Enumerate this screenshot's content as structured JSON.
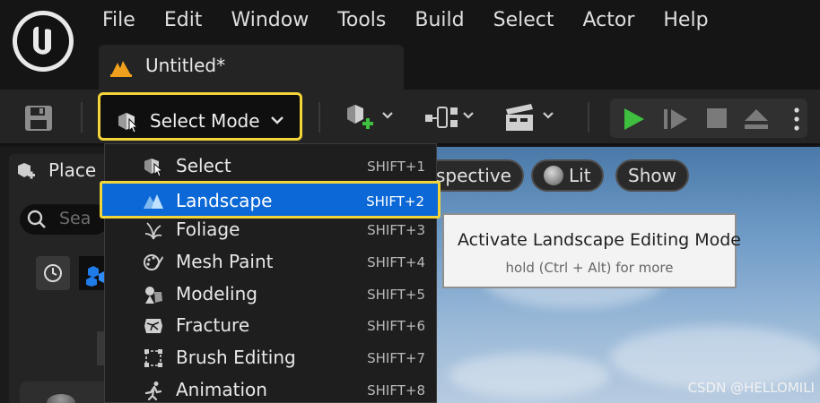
{
  "menu": [
    "File",
    "Edit",
    "Window",
    "Tools",
    "Build",
    "Select",
    "Actor",
    "Help"
  ],
  "document_tab": {
    "title": "Untitled*"
  },
  "toolbar": {
    "mode_button_label": "Select Mode",
    "accent_color": "#f3d53a",
    "play_color": "#3fbf3f"
  },
  "left_panel": {
    "tab_label": "Place",
    "search_placeholder": "Sea"
  },
  "viewport": {
    "perspective_label": "spective",
    "lit_label": "Lit",
    "show_label": "Show"
  },
  "mode_menu": {
    "items": [
      {
        "label": "Select",
        "shortcut": "SHIFT+1",
        "icon": "select-mode-icon"
      },
      {
        "label": "Landscape",
        "shortcut": "SHIFT+2",
        "icon": "landscape-mode-icon",
        "highlighted": true
      },
      {
        "label": "Foliage",
        "shortcut": "SHIFT+3",
        "icon": "foliage-mode-icon"
      },
      {
        "label": "Mesh Paint",
        "shortcut": "SHIFT+4",
        "icon": "mesh-paint-mode-icon"
      },
      {
        "label": "Modeling",
        "shortcut": "SHIFT+5",
        "icon": "modeling-mode-icon"
      },
      {
        "label": "Fracture",
        "shortcut": "SHIFT+6",
        "icon": "fracture-mode-icon"
      },
      {
        "label": "Brush Editing",
        "shortcut": "SHIFT+7",
        "icon": "brush-editing-mode-icon"
      },
      {
        "label": "Animation",
        "shortcut": "SHIFT+8",
        "icon": "animation-mode-icon"
      }
    ],
    "highlight_color": "#0b68d6"
  },
  "tooltip": {
    "title": "Activate Landscape Editing Mode",
    "subtitle": "hold (Ctrl + Alt) for more"
  },
  "watermark": "CSDN @HELLOMILI"
}
